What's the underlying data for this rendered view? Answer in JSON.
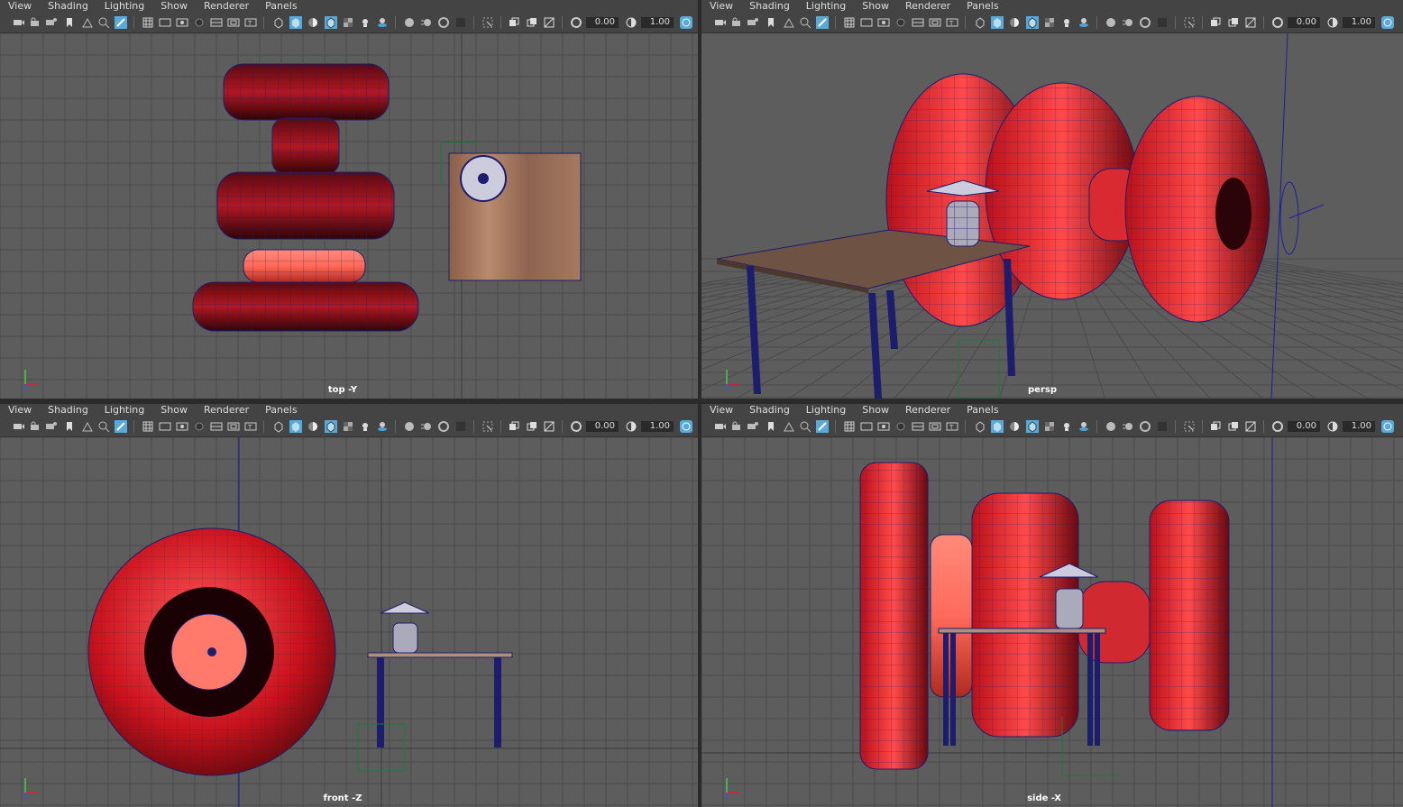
{
  "menu": [
    "View",
    "Shading",
    "Lighting",
    "Show",
    "Renderer",
    "Panels"
  ],
  "toolbar": {
    "field1": "0.00",
    "field2": "1.00"
  },
  "panels": [
    {
      "label": "top -Y"
    },
    {
      "label": "persp"
    },
    {
      "label": "front -Z"
    },
    {
      "label": "side -X"
    }
  ],
  "colors": {
    "viewport_bg": "#5d5d5d",
    "grid": "#4a4a4a",
    "object_red": "#d01c24",
    "wire": "#1d1d6e",
    "table_wood": "#8a6a58"
  }
}
